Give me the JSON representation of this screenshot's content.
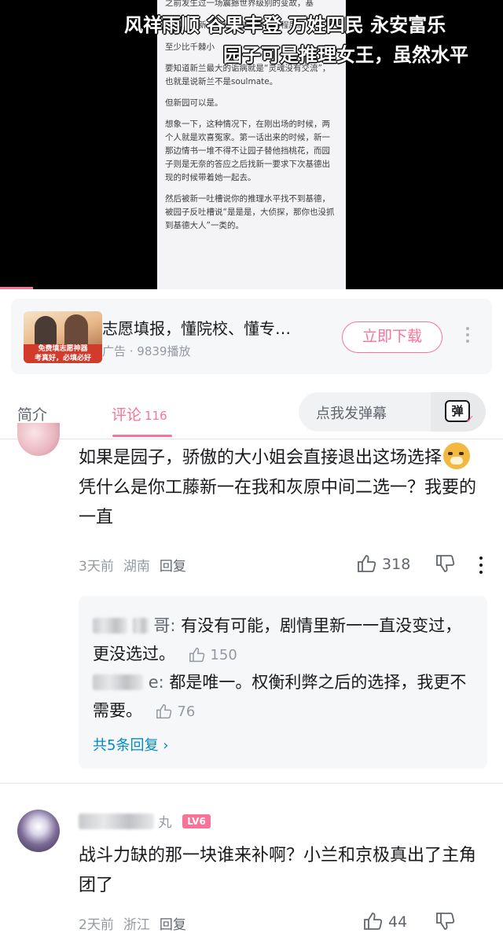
{
  "video": {
    "doc_lines": [
      "之前发生过一场震撼世界级别的变故，基",
      "于此，对新一都稍微有点残忍的程度。",
      "至少比千棘小",
      "至少比千棘小姐还要少些受到伤害",
      "要知道新兰最大的诟病就是“灵魂没有交流”，也就是说新兰不是soulmate。",
      "但新园可以是。",
      "想象一下，这种情况下，在刚出场的时候，两个人就是欢喜冤家。第一话出来的时候，新一那边情书一堆不得不让园子替他挡桃花，而园子则是无奈的答应之后找新一要求下次基德出现的时候带着她一起去。",
      "然后被新一吐槽说你的推理水平找不到基德，被园子反吐槽说“是是是，大侦探，那你也没抓到基德大人”一类的。"
    ],
    "danmaku": [
      "风祥雨顺 谷果丰登 万姓四民 永安富乐",
      "园子可是推理女王，虽然水平"
    ]
  },
  "ad": {
    "thumb_text": [
      "免费填志愿神器",
      "考真好，必填必好"
    ],
    "title": "志愿填报，懂院校、懂专…",
    "meta": "广告 · 9839播放",
    "download_label": "立即下载"
  },
  "tabs": {
    "intro": "简介",
    "comments": "评论",
    "comment_count": "116",
    "danmaku_placeholder": "点我发弹幕",
    "danmaku_icon": "弹"
  },
  "comments": [
    {
      "text_before": "如果是园子，骄傲的大小姐会直接退出这场选择",
      "emoji": "doge",
      "text_after": "凭什么是你工藤新一在我和灰原中间二选一？我要的一直",
      "time": "3天前",
      "location": "湖南",
      "reply_label": "回复",
      "likes": "318",
      "replies": [
        {
          "name_suffix": "哥:",
          "text": "有没有可能，剧情里新一一直没变过，更没选过。",
          "likes": "150"
        },
        {
          "name_suffix": "e:",
          "text": "都是唯一。权衡利弊之后的选择，我更不需要。",
          "likes": "76"
        }
      ],
      "all_replies_label": "共5条回复"
    },
    {
      "name": "丸",
      "level": "LV6",
      "text": "战斗力缺的那一块谁来补啊？小兰和京极真出了主角团了",
      "time": "2天前",
      "location": "浙江",
      "reply_label": "回复",
      "likes": "44"
    }
  ],
  "colors": {
    "accent": "#fb7299",
    "link": "#008ac5",
    "muted": "#9499a0"
  }
}
